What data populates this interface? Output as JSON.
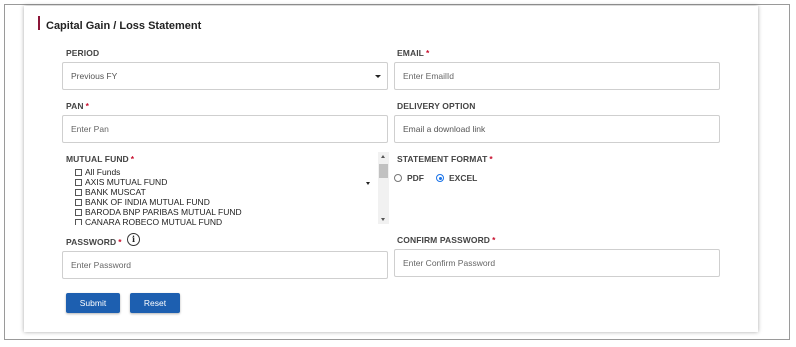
{
  "page": {
    "title": "Capital Gain / Loss Statement"
  },
  "colors": {
    "accent": "#8b1538",
    "button": "#1d5fb0",
    "required": "#c8102e",
    "radio_selected": "#1a73e8"
  },
  "period": {
    "label": "PERIOD",
    "value": "Previous FY"
  },
  "email": {
    "label": "EMAIL",
    "required": "*",
    "placeholder": "Enter EmailId"
  },
  "pan": {
    "label": "PAN",
    "required": "*",
    "placeholder": "Enter Pan"
  },
  "delivery": {
    "label": "DELIVERY OPTION",
    "value": "Email a download link"
  },
  "mutual_fund": {
    "label": "MUTUAL FUND",
    "required": "*",
    "options": [
      "All Funds",
      "AXIS MUTUAL FUND",
      "BANK MUSCAT",
      "BANK OF INDIA MUTUAL FUND",
      "BARODA BNP PARIBAS MUTUAL FUND",
      "CANARA ROBECO MUTUAL FUND"
    ]
  },
  "statement_format": {
    "label": "STATEMENT FORMAT",
    "required": "*",
    "options": [
      "PDF",
      "EXCEL"
    ],
    "selected": "EXCEL"
  },
  "password": {
    "label": "PASSWORD",
    "required": "*",
    "placeholder": "Enter Password",
    "info_icon": "info-icon"
  },
  "confirm_password": {
    "label": "CONFIRM PASSWORD",
    "required": "*",
    "placeholder": "Enter Confirm Password"
  },
  "buttons": {
    "submit": "Submit",
    "reset": "Reset"
  }
}
